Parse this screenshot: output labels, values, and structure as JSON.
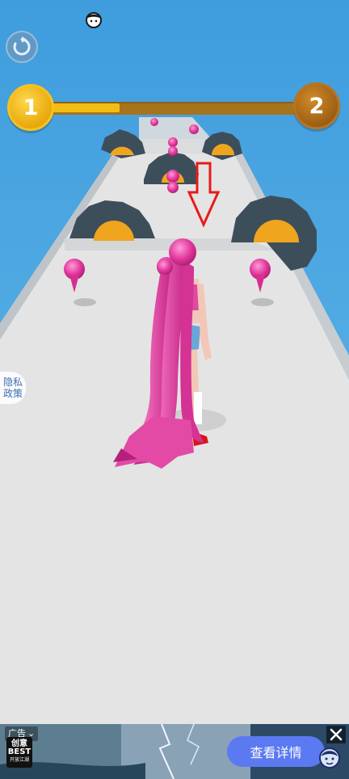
{
  "level": {
    "current": "1",
    "next": "2",
    "progress": 0.3
  },
  "privacy": {
    "line1": "隐私",
    "line2": "政策"
  },
  "ad": {
    "tag_label": "广告",
    "logo_line1": "创意",
    "logo_line2": "BEST",
    "logo_line3": "开放江湖",
    "cta_label": "查看详情"
  },
  "icons": {
    "restart": "restart-icon",
    "top": "character-head-icon",
    "close": "close-icon",
    "avatar": "cartoon-avatar-icon"
  },
  "colors": {
    "sky": "#4aa3df",
    "track": "#e4e4e4",
    "hair": "#e0359b",
    "progress_fill": "#f2bd12",
    "progress_track": "#a8731d",
    "cta": "#5b79f0"
  }
}
